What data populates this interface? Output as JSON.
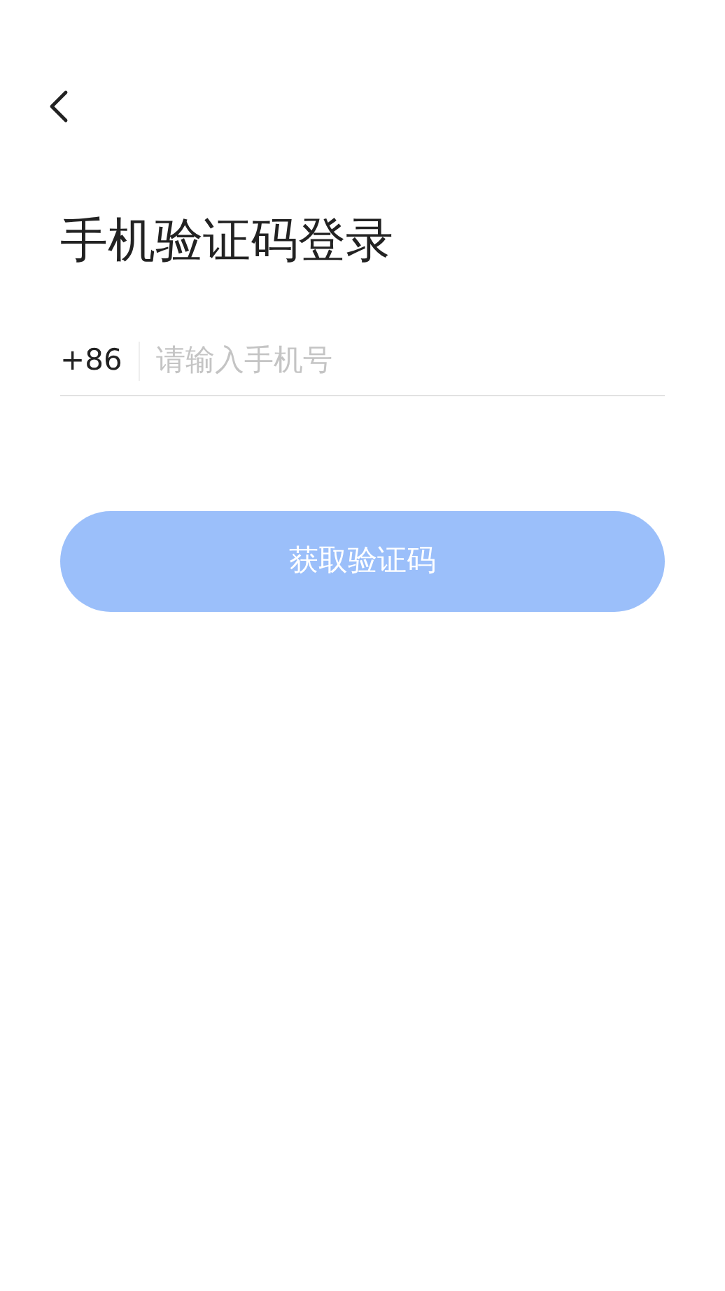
{
  "title": "手机验证码登录",
  "phone": {
    "country_code": "+86",
    "placeholder": "请输入手机号"
  },
  "submit": {
    "label": "获取验证码",
    "disabled": true
  }
}
